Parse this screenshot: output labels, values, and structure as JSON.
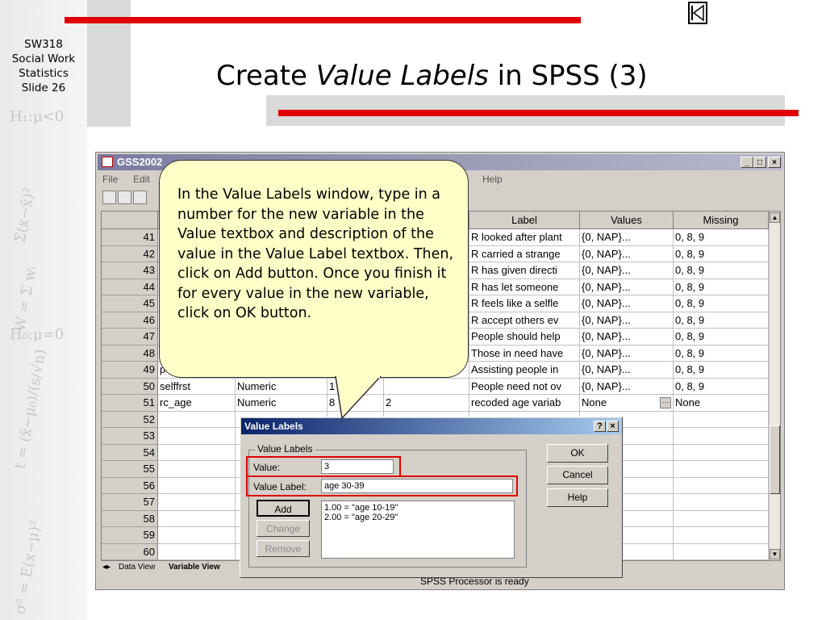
{
  "course": {
    "line1": "SW318",
    "line2": "Social Work",
    "line3": "Statistics",
    "line4": "Slide 26"
  },
  "slide_title": {
    "part1": "Create ",
    "part2": "Value Labels",
    "part3": " in SPSS (3)"
  },
  "spss_window": {
    "title": "GSS2002",
    "menus": [
      "File",
      "Edit",
      "Help"
    ],
    "status": "SPSS Processor  is ready",
    "tabs": {
      "data_view": "Data View",
      "variable_view": "Variable View"
    },
    "columns": {
      "label": "Label",
      "values": "Values",
      "missing": "Missing"
    },
    "rows": [
      {
        "n": "41",
        "name": "",
        "type": "",
        "width": "",
        "decimals": "",
        "label": "R looked after plant",
        "values": "{0, NAP}...",
        "missing": "0, 8, 9"
      },
      {
        "n": "42",
        "name": "",
        "type": "",
        "width": "",
        "decimals": "",
        "label": "R carried a strange",
        "values": "{0, NAP}...",
        "missing": "0, 8, 9"
      },
      {
        "n": "43",
        "name": "",
        "type": "",
        "width": "",
        "decimals": "",
        "label": "R has given directi",
        "values": "{0, NAP}...",
        "missing": "0, 8, 9"
      },
      {
        "n": "44",
        "name": "",
        "type": "",
        "width": "",
        "decimals": "",
        "label": "R has let someone",
        "values": "{0, NAP}...",
        "missing": "0, 8, 9"
      },
      {
        "n": "45",
        "name": "",
        "type": "",
        "width": "",
        "decimals": "",
        "label": "R feels like a selfle",
        "values": "{0, NAP}...",
        "missing": "0, 8, 9"
      },
      {
        "n": "46",
        "name": "",
        "type": "",
        "width": "",
        "decimals": "",
        "label": "R accept others ev",
        "values": "{0, NAP}...",
        "missing": "0, 8, 9"
      },
      {
        "n": "47",
        "name": "",
        "type": "",
        "width": "",
        "decimals": "",
        "label": "People should help",
        "values": "{0, NAP}...",
        "missing": "0, 8, 9"
      },
      {
        "n": "48",
        "name": "",
        "type": "",
        "width": "",
        "decimals": "",
        "label": "Those in need have",
        "values": "{0, NAP}...",
        "missing": "0, 8, 9"
      },
      {
        "n": "49",
        "name": "pe",
        "type": "",
        "width": "",
        "decimals": "",
        "label": "Assisting people in",
        "values": "{0, NAP}...",
        "missing": "0, 8, 9"
      },
      {
        "n": "50",
        "name": "selffrst",
        "type": "Numeric",
        "width": "1",
        "decimals": "",
        "label": "People need not ov",
        "values": "{0, NAP}...",
        "missing": "0, 8, 9"
      },
      {
        "n": "51",
        "name": "rc_age",
        "type": "Numeric",
        "width": "8",
        "decimals": "2",
        "label": "recoded age variab",
        "values": "None",
        "missing": "None"
      },
      {
        "n": "52",
        "name": "",
        "type": "",
        "width": "",
        "decimals": "",
        "label": "",
        "values": "",
        "missing": ""
      },
      {
        "n": "53",
        "name": "",
        "type": "",
        "width": "",
        "decimals": "",
        "label": "",
        "values": "",
        "missing": ""
      },
      {
        "n": "54",
        "name": "",
        "type": "",
        "width": "",
        "decimals": "",
        "label": "",
        "values": "",
        "missing": ""
      },
      {
        "n": "55",
        "name": "",
        "type": "",
        "width": "",
        "decimals": "",
        "label": "",
        "values": "",
        "missing": ""
      },
      {
        "n": "56",
        "name": "",
        "type": "",
        "width": "",
        "decimals": "",
        "label": "",
        "values": "",
        "missing": ""
      },
      {
        "n": "57",
        "name": "",
        "type": "",
        "width": "",
        "decimals": "",
        "label": "",
        "values": "",
        "missing": ""
      },
      {
        "n": "58",
        "name": "",
        "type": "",
        "width": "",
        "decimals": "",
        "label": "",
        "values": "",
        "missing": ""
      },
      {
        "n": "59",
        "name": "",
        "type": "",
        "width": "",
        "decimals": "",
        "label": "",
        "values": "",
        "missing": ""
      },
      {
        "n": "60",
        "name": "",
        "type": "",
        "width": "",
        "decimals": "",
        "label": "",
        "values": "",
        "missing": ""
      }
    ]
  },
  "dialog": {
    "title": "Value Labels",
    "group_label": "Value Labels",
    "value_label": "Value:",
    "value_input": "3",
    "value_label_label": "Value Label:",
    "value_label_input": "age 30-39",
    "list_items": [
      "1.00 = \"age 10-19\"",
      "2.00 = \"age 20-29\""
    ],
    "buttons": {
      "ok": "OK",
      "cancel": "Cancel",
      "help": "Help",
      "add": "Add",
      "change": "Change",
      "remove": "Remove",
      "qmark": "?",
      "close": "×"
    }
  },
  "callout": {
    "text": "In the Value Labels window, type in a number for the new variable in the Value textbox and description of the value in the Value Label textbox. Then, click on Add button. Once you finish it for every value in the new variable, click on OK button."
  },
  "colors": {
    "accent_red": "#e00000",
    "callout_bg": "#ffffc8",
    "dialog_title": "#0a246a"
  }
}
